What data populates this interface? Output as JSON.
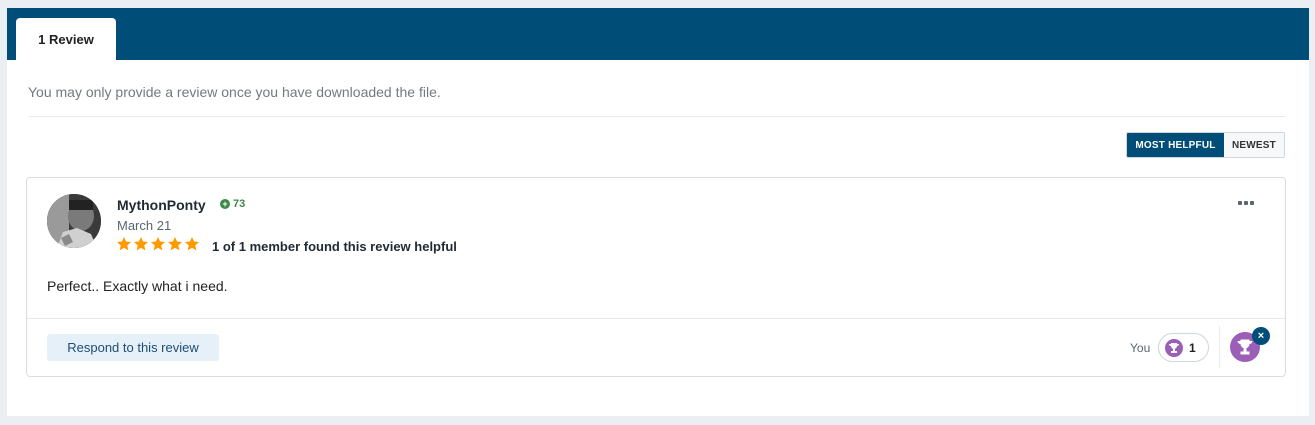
{
  "tabs": [
    {
      "label": "1 Review"
    }
  ],
  "notice": "You may only provide a review once you have downloaded the file.",
  "sort": {
    "most_helpful": "MOST HELPFUL",
    "newest": "NEWEST"
  },
  "review": {
    "author": "MythonPonty",
    "reputation": "73",
    "date": "March 21",
    "rating": 5,
    "helpful_text": "1 of 1 member found this review helpful",
    "content": "Perfect.. Exactly what i need.",
    "respond_label": "Respond to this review",
    "reactions": {
      "you_label": "You",
      "count": "1"
    }
  },
  "colors": {
    "brand": "#004d77",
    "star": "#ff9900",
    "reaction": "#9b5fb8",
    "reputation": "#3b8a45"
  },
  "icons": [
    "reputation-plus-icon",
    "star-icon",
    "ellipsis-icon",
    "trophy-icon",
    "close-icon"
  ]
}
